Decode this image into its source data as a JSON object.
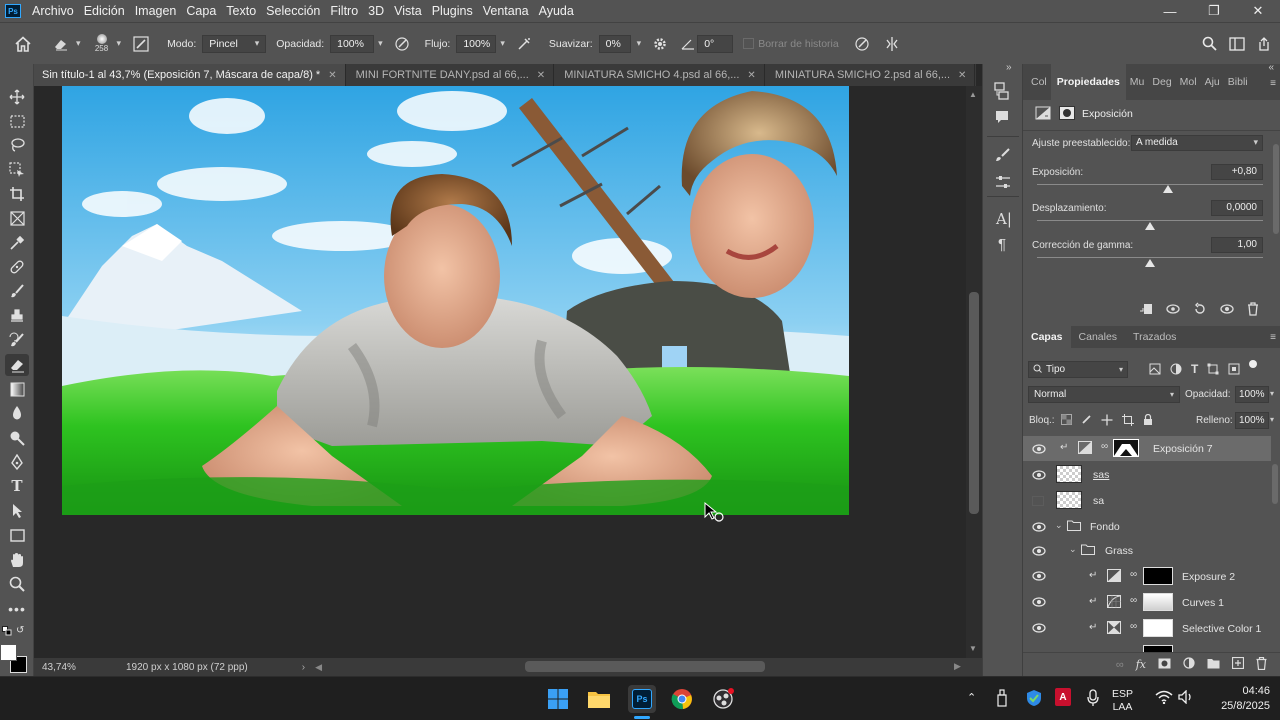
{
  "menubar": {
    "logo": "Ps",
    "items": [
      "Archivo",
      "Edición",
      "Imagen",
      "Capa",
      "Texto",
      "Selección",
      "Filtro",
      "3D",
      "Vista",
      "Plugins",
      "Ventana",
      "Ayuda"
    ]
  },
  "options": {
    "brush_size": "258",
    "mode_label": "Modo:",
    "mode_value": "Pincel",
    "opacity_label": "Opacidad:",
    "opacity_value": "100%",
    "flow_label": "Flujo:",
    "flow_value": "100%",
    "smooth_label": "Suavizar:",
    "smooth_value": "0%",
    "angle_value": "0°",
    "erase_history": "Borrar de historia"
  },
  "tabs": [
    {
      "label": "Sin título-1 al 43,7% (Exposición 7, Máscara de capa/8) *",
      "active": true
    },
    {
      "label": "MINI FORTNITE DANY.psd al 66,...",
      "active": false
    },
    {
      "label": "MINIATURA SMICHO 4.psd al 66,...",
      "active": false
    },
    {
      "label": "MINIATURA SMICHO 2.psd al 66,...",
      "active": false
    }
  ],
  "status": {
    "zoom": "43,74%",
    "doc_size": "1920 px x 1080 px (72 ppp)"
  },
  "properties": {
    "tabs": [
      "Col",
      "Propiedades",
      "Mu",
      "Deg",
      "Mol",
      "Aju",
      "Bibli"
    ],
    "title": "Exposición",
    "preset_label": "Ajuste preestablecido:",
    "preset_value": "A medida",
    "exposure_label": "Exposición:",
    "exposure_value": "+0,80",
    "exposure_level": 0.58,
    "offset_label": "Desplazamiento:",
    "offset_value": "0,0000",
    "offset_level": 0.5,
    "gamma_label": "Corrección de gamma:",
    "gamma_value": "1,00",
    "gamma_level": 0.5
  },
  "layers_panel": {
    "tabs": [
      "Capas",
      "Canales",
      "Trazados"
    ],
    "filter_value": "Tipo",
    "blend_mode": "Normal",
    "opacity_label": "Opacidad:",
    "opacity_value": "100%",
    "lock_label": "Bloq.:",
    "fill_label": "Relleno:",
    "fill_value": "100%",
    "layers": [
      {
        "name": "Exposición 7",
        "visible": true,
        "selected": true
      },
      {
        "name": "sas",
        "visible": true,
        "selected": false
      },
      {
        "name": "sa",
        "visible": false,
        "selected": false
      },
      {
        "name": "Fondo",
        "visible": true,
        "selected": false
      },
      {
        "name": "Grass",
        "visible": true,
        "selected": false
      },
      {
        "name": "Exposure 2",
        "visible": true,
        "selected": false
      },
      {
        "name": "Curves 1",
        "visible": true,
        "selected": false
      },
      {
        "name": "Selective Color 1",
        "visible": true,
        "selected": false
      }
    ]
  },
  "taskbar": {
    "lang_top": "ESP",
    "lang_bottom": "LAA",
    "time": "04:46",
    "date": "25/8/2025"
  },
  "colors": {
    "accent": "#31a8ff",
    "ps_blue": "#001e36",
    "sky": "#4fb6e8",
    "grass": "#31c52a"
  }
}
